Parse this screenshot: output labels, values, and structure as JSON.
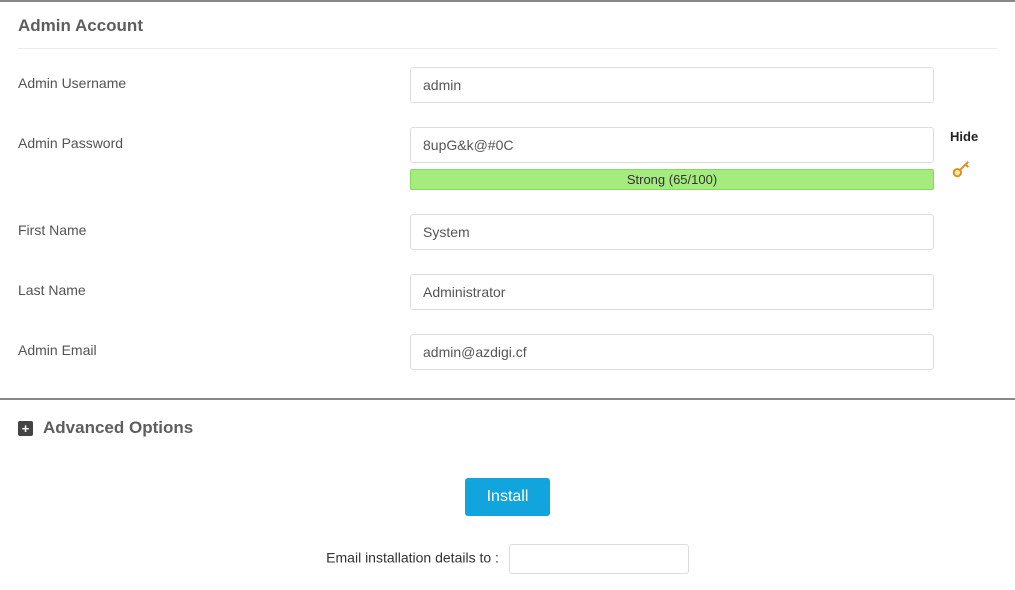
{
  "section_title": "Admin Account",
  "fields": {
    "username": {
      "label": "Admin Username",
      "value": "admin"
    },
    "password": {
      "label": "Admin Password",
      "value": "8upG&k@#0C",
      "hide_label": "Hide",
      "strength_text": "Strong (65/100)"
    },
    "firstname": {
      "label": "First Name",
      "value": "System"
    },
    "lastname": {
      "label": "Last Name",
      "value": "Administrator"
    },
    "email": {
      "label": "Admin Email",
      "value": "admin@azdigi.cf"
    }
  },
  "advanced_label": "Advanced Options",
  "install_button": "Install",
  "email_details_label": "Email installation details to :",
  "email_details_value": ""
}
